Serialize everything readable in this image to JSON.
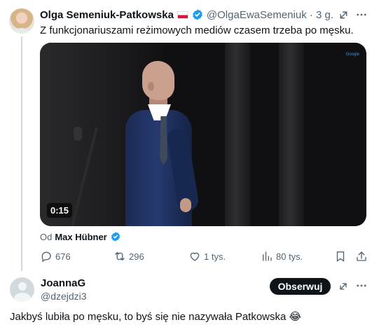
{
  "post": {
    "author_name": "Olga Semeniuk-Patkowska",
    "flag_icon": "poland-flag-icon",
    "verified_icon": "verified-badge-icon",
    "handle": "@OlgaEwaSemeniuk · 3 g.",
    "text": "Z funkcjonariuszami reżimowych mediów czasem trzeba po męsku.",
    "video": {
      "timecode": "0:15",
      "watermark": "Google",
      "play_state": "paused"
    },
    "attribution_prefix": "Od",
    "attribution_author": "Max Hübner",
    "actions": {
      "replies": "676",
      "reposts": "296",
      "likes": "1 tys.",
      "views": "80 tys."
    },
    "icons": [
      "grok-icon",
      "more-icon",
      "reply-icon",
      "repost-icon",
      "like-icon",
      "views-icon",
      "bookmark-icon",
      "share-icon"
    ]
  },
  "reply_card": {
    "name": "JoannaG",
    "handle": "@dzejdzi3",
    "follow_label": "Obserwuj",
    "text": "Jakbyś lubiła po męsku, to byś się nie nazywała Patkowska 😂"
  },
  "colors": {
    "text": "#0f1419",
    "secondary_text": "#536471",
    "verified_blue": "#1d9bf0",
    "follow_button": "#0f1419"
  }
}
